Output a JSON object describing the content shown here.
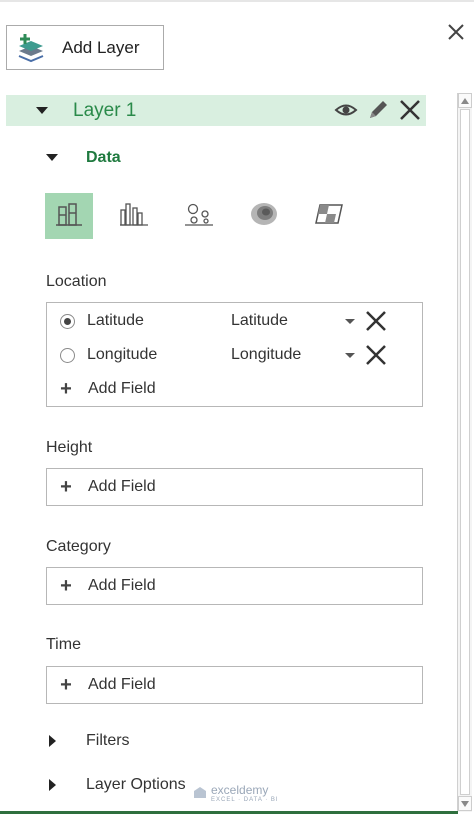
{
  "toolbar": {
    "add_layer_label": "Add Layer"
  },
  "layer": {
    "name": "Layer 1"
  },
  "data_section": {
    "title": "Data"
  },
  "visualizations": [
    "stacked-column",
    "clustered-column",
    "bubble",
    "heat-map",
    "region"
  ],
  "location": {
    "label": "Location",
    "fields": [
      {
        "name": "Latitude",
        "value": "Latitude",
        "selected": true
      },
      {
        "name": "Longitude",
        "value": "Longitude",
        "selected": false
      }
    ],
    "add_field": "Add Field"
  },
  "height": {
    "label": "Height",
    "add_field": "Add Field"
  },
  "category": {
    "label": "Category",
    "add_field": "Add Field"
  },
  "time": {
    "label": "Time",
    "add_field": "Add Field"
  },
  "filters": {
    "label": "Filters"
  },
  "layer_options": {
    "label": "Layer Options"
  },
  "watermark": {
    "brand": "exceldemy",
    "tagline": "EXCEL · DATA · BI"
  },
  "colors": {
    "layer_bg": "#d9efe0",
    "accent_green": "#1f7a3f",
    "selected_viz": "#a3d6b2"
  }
}
